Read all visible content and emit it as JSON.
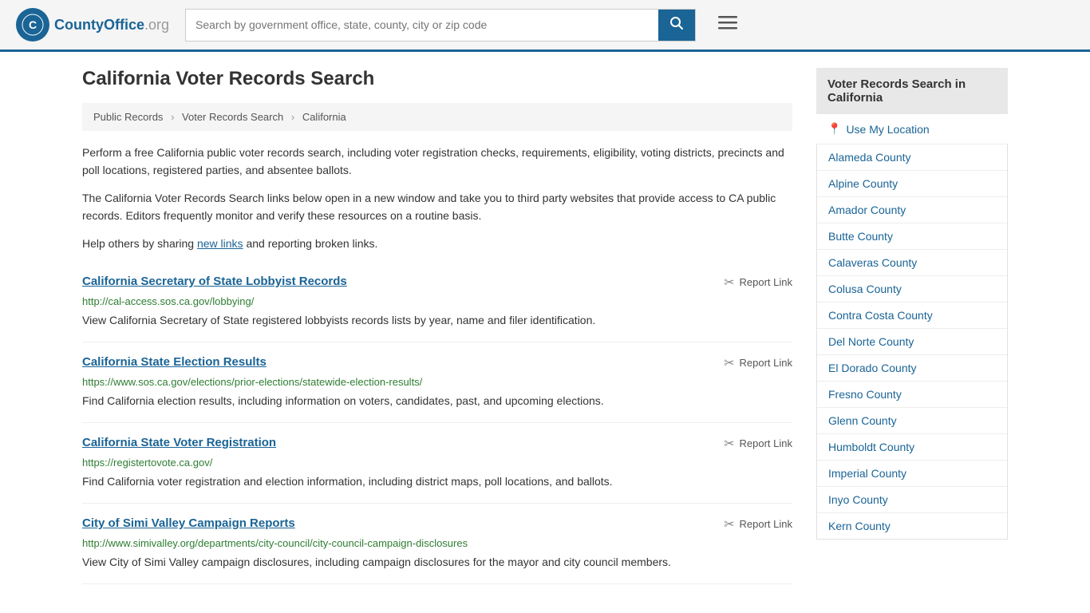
{
  "header": {
    "logo_text": "CountyOffice",
    "logo_suffix": ".org",
    "search_placeholder": "Search by government office, state, county, city or zip code"
  },
  "page": {
    "title": "California Voter Records Search",
    "breadcrumb": {
      "items": [
        "Public Records",
        "Voter Records Search",
        "California"
      ]
    },
    "intro": [
      "Perform a free California public voter records search, including voter registration checks, requirements, eligibility, voting districts, precincts and poll locations, registered parties, and absentee ballots.",
      "The California Voter Records Search links below open in a new window and take you to third party websites that provide access to CA public records. Editors frequently monitor and verify these resources on a routine basis.",
      "Help others by sharing new links and reporting broken links."
    ],
    "records": [
      {
        "title": "California Secretary of State Lobbyist Records",
        "url": "http://cal-access.sos.ca.gov/lobbying/",
        "description": "View California Secretary of State registered lobbyists records lists by year, name and filer identification.",
        "report_label": "Report Link"
      },
      {
        "title": "California State Election Results",
        "url": "https://www.sos.ca.gov/elections/prior-elections/statewide-election-results/",
        "description": "Find California election results, including information on voters, candidates, past, and upcoming elections.",
        "report_label": "Report Link"
      },
      {
        "title": "California State Voter Registration",
        "url": "https://registertovote.ca.gov/",
        "description": "Find California voter registration and election information, including district maps, poll locations, and ballots.",
        "report_label": "Report Link"
      },
      {
        "title": "City of Simi Valley Campaign Reports",
        "url": "http://www.simivalley.org/departments/city-council/city-council-campaign-disclosures",
        "description": "View City of Simi Valley campaign disclosures, including campaign disclosures for the mayor and city council members.",
        "report_label": "Report Link"
      }
    ]
  },
  "sidebar": {
    "title": "Voter Records Search in California",
    "use_location_label": "Use My Location",
    "counties": [
      "Alameda County",
      "Alpine County",
      "Amador County",
      "Butte County",
      "Calaveras County",
      "Colusa County",
      "Contra Costa County",
      "Del Norte County",
      "El Dorado County",
      "Fresno County",
      "Glenn County",
      "Humboldt County",
      "Imperial County",
      "Inyo County",
      "Kern County"
    ]
  }
}
